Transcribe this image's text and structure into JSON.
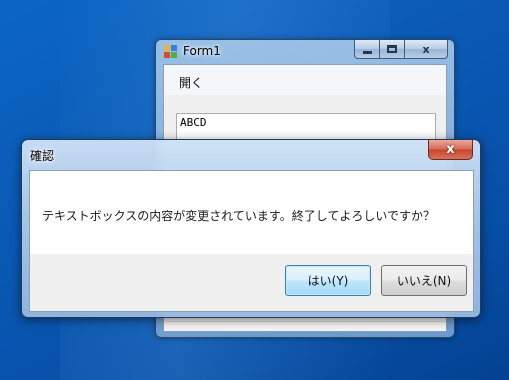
{
  "form_window": {
    "title": "Form1",
    "menu": {
      "open_label": "開く"
    },
    "textbox": {
      "value": "ABCD"
    }
  },
  "dialog": {
    "title": "確認",
    "close_glyph": "x",
    "message": "テキストボックスの内容が変更されています。終了してよろしいですか？",
    "yes_label": "はい(Y)",
    "no_label": "いいえ(N)"
  },
  "theme": {
    "desktop": "#0a58b4",
    "window_frame": "#a8c4e2",
    "close_button": "#c7462f",
    "default_button_border": "#3c7fb1"
  }
}
